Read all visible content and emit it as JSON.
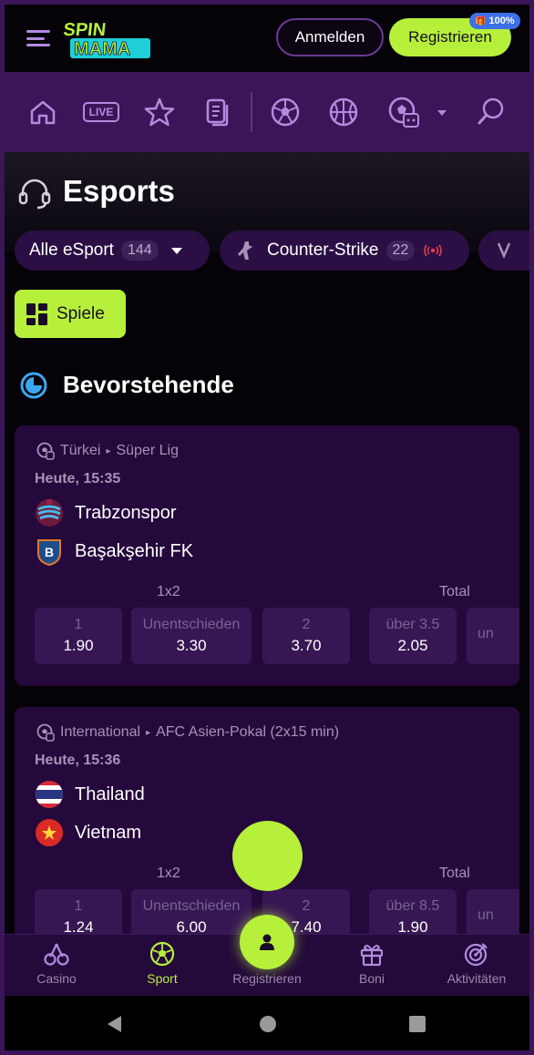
{
  "header": {
    "login_label": "Anmelden",
    "register_label": "Registrieren",
    "bonus_badge": "100%",
    "logo_line1": "SPIN",
    "logo_line2": "MAMA"
  },
  "nav": {
    "icons": [
      "home-icon",
      "live-icon",
      "star-icon",
      "betslip-icon",
      "soccer-icon",
      "basketball-icon",
      "more-sports-icon",
      "search-icon"
    ],
    "live_label": "LIVE"
  },
  "page": {
    "title": "Esports",
    "filters": [
      {
        "label": "Alle eSport",
        "count": "144"
      },
      {
        "label": "Counter-Strike",
        "count": "22"
      }
    ],
    "games_button": "Spiele",
    "section_title": "Bevorstehende"
  },
  "matches": [
    {
      "country": "Türkei",
      "league": "Süper Lig",
      "time": "Heute, 15:35",
      "team1": "Trabzonspor",
      "team2": "Başakşehir FK",
      "market1_label": "1x2",
      "market2_label": "Total",
      "odds": [
        {
          "label": "1",
          "value": "1.90"
        },
        {
          "label": "Unentschieden",
          "value": "3.30"
        },
        {
          "label": "2",
          "value": "3.70"
        },
        {
          "label": "über 3.5",
          "value": "2.05"
        },
        {
          "label": "un",
          "value": ""
        }
      ]
    },
    {
      "country": "International",
      "league": "AFC Asien-Pokal (2x15 min)",
      "time": "Heute, 15:36",
      "team1": "Thailand",
      "team2": "Vietnam",
      "market1_label": "1x2",
      "market2_label": "Total",
      "odds": [
        {
          "label": "1",
          "value": "1.24"
        },
        {
          "label": "Unentschieden",
          "value": "6.00"
        },
        {
          "label": "2",
          "value": "7.40"
        },
        {
          "label": "über 8.5",
          "value": "1.90"
        },
        {
          "label": "un",
          "value": ""
        }
      ]
    }
  ],
  "bottom_nav": [
    {
      "label": "Casino",
      "icon": "cherry-icon"
    },
    {
      "label": "Sport",
      "icon": "soccer-ball-icon"
    },
    {
      "label": "Registrieren",
      "icon": "user-icon"
    },
    {
      "label": "Boni",
      "icon": "gift-icon"
    },
    {
      "label": "Aktivitäten",
      "icon": "target-icon"
    }
  ],
  "colors": {
    "accent": "#b6f03a",
    "nav_bg": "#3a1658",
    "card_bg": "#25093c",
    "odd_bg": "#371653",
    "text_muted": "#a593b7"
  }
}
